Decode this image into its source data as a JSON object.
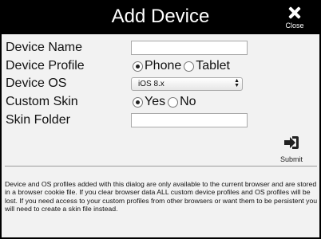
{
  "header": {
    "title": "Add Device",
    "close_label": "Close"
  },
  "form": {
    "device_name_label": "Device Name",
    "device_name_value": "",
    "device_profile_label": "Device Profile",
    "profile_options": [
      "Phone",
      "Tablet"
    ],
    "profile_selected": "Phone",
    "device_os_label": "Device OS",
    "device_os_value": "iOS 8.x",
    "custom_skin_label": "Custom Skin",
    "skin_options": [
      "Yes",
      "No"
    ],
    "skin_selected": "Yes",
    "skin_folder_label": "Skin Folder",
    "skin_folder_value": ""
  },
  "submit_label": "Submit",
  "note": "Device and OS profiles added with this dialog are only available to the current browser and are stored in a browser cookie file. If you clear browser data ALL custom device profiles and OS profiles will be lost. If you need access to your custom profiles from other browsers or want them to be persistent you will need to create a skin file instead."
}
